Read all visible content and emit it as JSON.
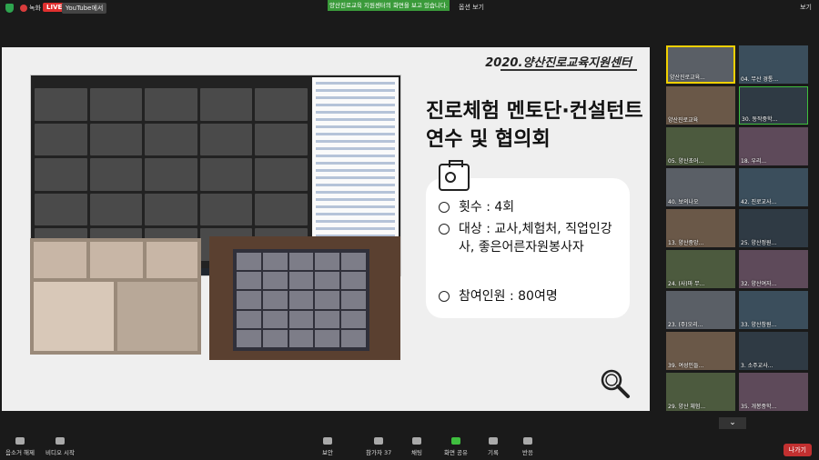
{
  "topbar": {
    "rec": "녹화",
    "live": "LIVE",
    "youtube": "YouTube에서",
    "banner": "양산진로교육 지원센터의 화면을 보고 있습니다.",
    "view_options": "옵션 보기",
    "screen_label": "보기"
  },
  "slide": {
    "org": "2020.양산진로교육지원센터",
    "title_line1": "진로체험 멘토단·컨설턴트",
    "title_line2": "연수 및 협의회",
    "item1": "횟수 : 4회",
    "item2": "대상 : 교사,체험처, 직업인강사, 좋은어른자원봉사자",
    "item3": "참여인원 : 80여명"
  },
  "participants": [
    "양산진로교육...",
    "04. 무산 경통...",
    "양산진로교육",
    "30. 동작중학...",
    "05. 양산초어...",
    "18. 우리...",
    "40. 보의나오",
    "42. 진로교사...",
    "13. 양산중앙...",
    "25. 양산정원...",
    "24. (사)마 무...",
    "32. 양산여자...",
    "23. (주)오리...",
    "33. 양산창원...",
    "39. 여성인들...",
    "3. 소주교사...",
    "29. 양산 체험...",
    "35. 개봉중학..."
  ],
  "toolbar": {
    "audio": "음소거 해제",
    "video": "비디오 시작",
    "security": "보안",
    "participants": "참가자",
    "participant_count": "37",
    "chat": "채팅",
    "share": "화면 공유",
    "record": "기록",
    "reactions": "반응",
    "leave": "나가기"
  },
  "colors": {
    "live": "#e0302f",
    "banner": "#3a9a3a",
    "active_speaker": "#f0d000",
    "leave": "#c23030"
  }
}
